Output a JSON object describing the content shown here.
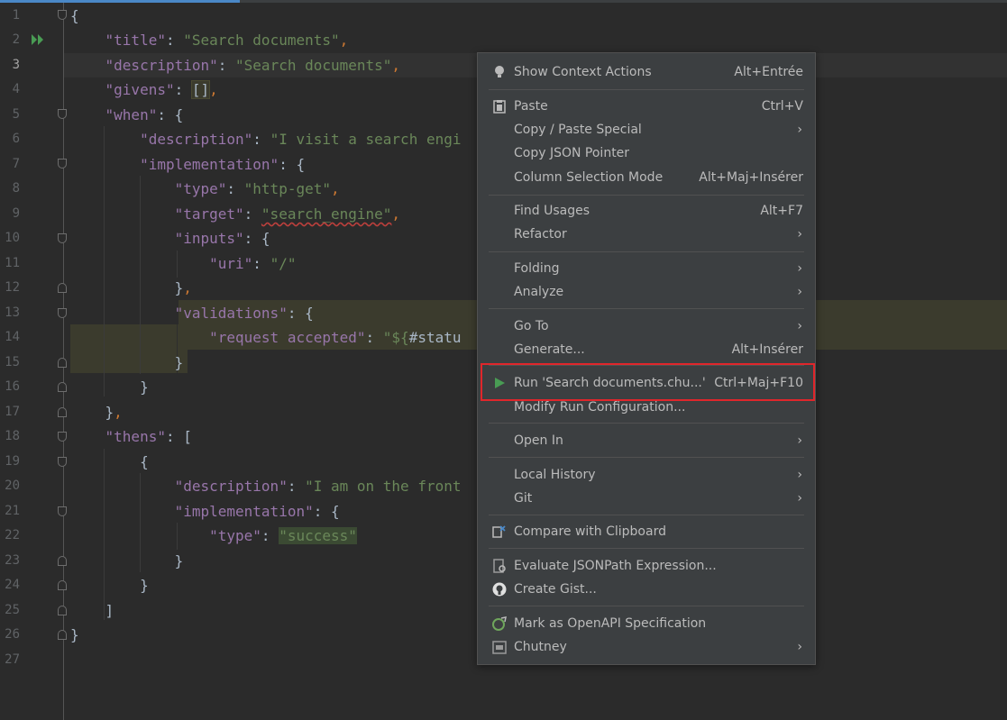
{
  "editor": {
    "line_numbers": [
      "1",
      "2",
      "3",
      "4",
      "5",
      "6",
      "7",
      "8",
      "9",
      "10",
      "11",
      "12",
      "13",
      "14",
      "15",
      "16",
      "17",
      "18",
      "19",
      "20",
      "21",
      "22",
      "23",
      "24",
      "25",
      "26",
      "27"
    ],
    "code": {
      "open_brace": "{",
      "title_key": "\"title\"",
      "title_val": "\"Search documents\"",
      "desc_key": "\"description\"",
      "desc_val": "\"Search documents\"",
      "givens_key": "\"givens\"",
      "givens_val": "[]",
      "when_key": "\"when\"",
      "when_desc_key": "\"description\"",
      "when_desc_val": "\"I visit a search engi",
      "impl_key": "\"implementation\"",
      "type_key": "\"type\"",
      "type_val": "\"http-get\"",
      "target_key": "\"target\"",
      "target_val": "\"search_engine\"",
      "inputs_key": "\"inputs\"",
      "uri_key": "\"uri\"",
      "uri_val": "\"/\"",
      "validations_key": "\"validations\"",
      "request_key": "\"request accepted\"",
      "request_val_prefix": "\"${",
      "request_val_rest": "#statu",
      "thens_key": "\"thens\"",
      "then_desc_key": "\"description\"",
      "then_desc_val": "\"I am on the front",
      "impl2_key": "\"implementation\"",
      "type2_key": "\"type\"",
      "type2_val": "\"success\""
    }
  },
  "context_menu": {
    "items": [
      {
        "label": "Show Context Actions",
        "shortcut": "Alt+Entrée",
        "icon": "bulb-icon"
      },
      {
        "label": "Paste",
        "shortcut": "Ctrl+V",
        "icon": "clipboard-icon"
      },
      {
        "label": "Copy / Paste Special",
        "submenu": "›"
      },
      {
        "label": "Copy JSON Pointer"
      },
      {
        "label": "Column Selection Mode",
        "shortcut": "Alt+Maj+Insérer"
      },
      {
        "label": "Find Usages",
        "shortcut": "Alt+F7"
      },
      {
        "label": "Refactor",
        "submenu": "›"
      },
      {
        "label": "Folding",
        "submenu": "›"
      },
      {
        "label": "Analyze",
        "submenu": "›"
      },
      {
        "label": "Go To",
        "submenu": "›"
      },
      {
        "label": "Generate...",
        "shortcut": "Alt+Insérer"
      },
      {
        "label": "Run 'Search documents.chu...'",
        "shortcut": "Ctrl+Maj+F10",
        "icon": "run-icon"
      },
      {
        "label": "Modify Run Configuration..."
      },
      {
        "label": "Open In",
        "submenu": "›"
      },
      {
        "label": "Local History",
        "submenu": "›"
      },
      {
        "label": "Git",
        "submenu": "›"
      },
      {
        "label": "Compare with Clipboard",
        "icon": "compare-icon"
      },
      {
        "label": "Evaluate JSONPath Expression...",
        "icon": "jsonpath-icon"
      },
      {
        "label": "Create Gist...",
        "icon": "github-icon"
      },
      {
        "label": "Mark as OpenAPI Specification",
        "icon": "openapi-icon"
      },
      {
        "label": "Chutney",
        "submenu": "›",
        "icon": "chutney-icon"
      }
    ]
  },
  "colors": {
    "background": "#2b2b2b",
    "menu_background": "#3c3f41",
    "highlight_border": "#e0262b",
    "run_green": "#499c54"
  }
}
